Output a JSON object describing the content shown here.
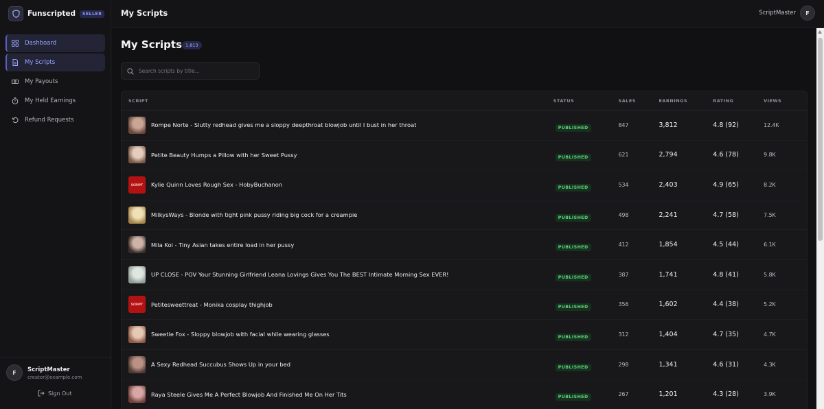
{
  "brand": {
    "name": "Funscripted",
    "badge": "SELLER"
  },
  "nav": [
    {
      "label": "Dashboard",
      "icon": "grid-icon",
      "active": true
    },
    {
      "label": "My Scripts",
      "icon": "document-icon",
      "active": true
    },
    {
      "label": "My Payouts",
      "icon": "banknote-icon",
      "active": false
    },
    {
      "label": "My Held Earnings",
      "icon": "timer-icon",
      "active": false
    },
    {
      "label": "Refund Requests",
      "icon": "undo-icon",
      "active": false
    }
  ],
  "user": {
    "initial": "F",
    "name": "ScriptMaster",
    "email": "creator@example.com",
    "signout_label": "Sign Out"
  },
  "topbar": {
    "title": "My Scripts",
    "username": "ScriptMaster",
    "initial": "F"
  },
  "page": {
    "title": "My Scripts",
    "count": "1,813"
  },
  "search": {
    "placeholder": "Search scripts by title...",
    "value": ""
  },
  "table": {
    "headers": {
      "script": "SCRIPT",
      "status": "STATUS",
      "sales": "SALES",
      "earnings": "EARNINGS",
      "rating": "RATING",
      "views": "VIEWS"
    },
    "rows": [
      {
        "title": "Rompe Norte - Slutty redhead gives me a sloppy deepthroat blowjob until I bust in her throat",
        "status": "PUBLISHED",
        "sales": "847",
        "earnings": "3,812",
        "rating": "4.8 (92)",
        "views": "12.4K",
        "thumb": "photo"
      },
      {
        "title": "Petite Beauty Humps a Pillow with her Sweet Pussy",
        "status": "PUBLISHED",
        "sales": "621",
        "earnings": "2,794",
        "rating": "4.6 (78)",
        "views": "9.8K",
        "thumb": "photo"
      },
      {
        "title": "Kylie Quinn Loves Rough Sex - HobyBuchanon",
        "status": "PUBLISHED",
        "sales": "534",
        "earnings": "2,403",
        "rating": "4.9 (65)",
        "views": "8.2K",
        "thumb": "red"
      },
      {
        "title": "MilkysWays - Blonde with tight pink pussy riding big cock for a creampie",
        "status": "PUBLISHED",
        "sales": "498",
        "earnings": "2,241",
        "rating": "4.7 (58)",
        "views": "7.5K",
        "thumb": "photo"
      },
      {
        "title": "Mila Koi - Tiny Asian takes entire load in her pussy",
        "status": "PUBLISHED",
        "sales": "412",
        "earnings": "1,854",
        "rating": "4.5 (44)",
        "views": "6.1K",
        "thumb": "photo"
      },
      {
        "title": "UP CLOSE - POV Your Stunning Girlfriend Leana Lovings Gives You The BEST Intimate Morning Sex EVER!",
        "status": "PUBLISHED",
        "sales": "387",
        "earnings": "1,741",
        "rating": "4.8 (41)",
        "views": "5.8K",
        "thumb": "photo"
      },
      {
        "title": "Petitesweettreat - Monika cosplay thighjob",
        "status": "PUBLISHED",
        "sales": "356",
        "earnings": "1,602",
        "rating": "4.4 (38)",
        "views": "5.2K",
        "thumb": "red"
      },
      {
        "title": "Sweetie Fox - Sloppy blowjob with facial while wearing glasses",
        "status": "PUBLISHED",
        "sales": "312",
        "earnings": "1,404",
        "rating": "4.7 (35)",
        "views": "4.7K",
        "thumb": "photo"
      },
      {
        "title": "A Sexy Redhead Succubus Shows Up in your bed",
        "status": "PUBLISHED",
        "sales": "298",
        "earnings": "1,341",
        "rating": "4.6 (31)",
        "views": "4.3K",
        "thumb": "photo"
      },
      {
        "title": "Raya Steele Gives Me A Perfect Blowjob And Finished Me On Her Tits",
        "status": "PUBLISHED",
        "sales": "267",
        "earnings": "1,201",
        "rating": "4.3 (28)",
        "views": "3.9K",
        "thumb": "photo"
      }
    ]
  },
  "colors": {
    "accent": "#5960c8",
    "published": "#5fd57c",
    "background": "#141416"
  }
}
